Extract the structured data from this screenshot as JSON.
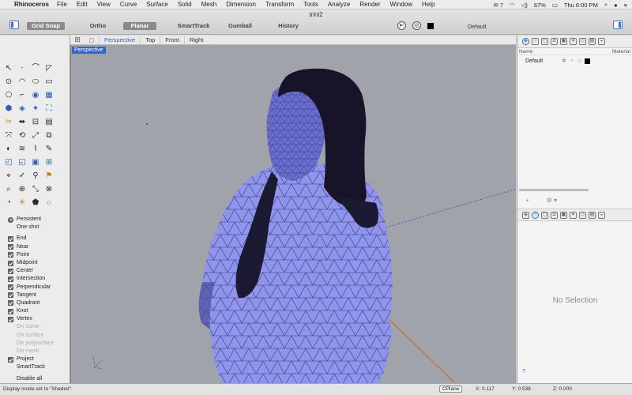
{
  "menubar": {
    "app_name": "Rhinoceros",
    "items": [
      "File",
      "Edit",
      "View",
      "Curve",
      "Surface",
      "Solid",
      "Mesh",
      "Dimension",
      "Transform",
      "Tools",
      "Analyze",
      "Render",
      "Window",
      "Help"
    ],
    "status": {
      "notification_count": "7",
      "battery": "67%",
      "clock": "Thu 6:00 PM"
    }
  },
  "window": {
    "title": "trini2"
  },
  "toolbar": {
    "toggles": [
      {
        "label": "Grid Snap",
        "on": true
      },
      {
        "label": "Ortho",
        "on": false
      },
      {
        "label": "Planar",
        "on": true
      },
      {
        "label": "SmartTrack",
        "on": false
      },
      {
        "label": "Gumball",
        "on": false
      },
      {
        "label": "History",
        "on": false
      }
    ],
    "current_layer": "Default"
  },
  "viewport": {
    "tabs": [
      "Perspective",
      "Top",
      "Front",
      "Right"
    ],
    "active_tab": "Perspective",
    "label": "Perspective",
    "colors": {
      "background": "#a1a3ab",
      "mesh_fill": "#8f95ec",
      "mesh_dark": "#6a6fcf",
      "hair": "#17142a",
      "wire": "#1e1f4a"
    }
  },
  "osnap": {
    "mode_items": [
      {
        "label": "Persistent",
        "checked": true,
        "radio": true
      },
      {
        "label": "One shot",
        "checked": false,
        "radio": true
      }
    ],
    "items": [
      {
        "label": "End",
        "checked": true
      },
      {
        "label": "Near",
        "checked": true
      },
      {
        "label": "Point",
        "checked": true
      },
      {
        "label": "Midpoint",
        "checked": true
      },
      {
        "label": "Center",
        "checked": true
      },
      {
        "label": "Intersection",
        "checked": true
      },
      {
        "label": "Perpendicular",
        "checked": true
      },
      {
        "label": "Tangent",
        "checked": true
      },
      {
        "label": "Quadrant",
        "checked": true
      },
      {
        "label": "Knot",
        "checked": true
      },
      {
        "label": "Vertex",
        "checked": true
      }
    ],
    "sub_items": [
      "On curve",
      "On surface",
      "On polysurface",
      "On mesh"
    ],
    "extra_items": [
      {
        "label": "Project",
        "checked": true
      },
      {
        "label": "SmartTrack",
        "checked": false
      }
    ],
    "disable_all": "Disable all"
  },
  "layers_panel": {
    "col_name": "Name",
    "col_material": "Material",
    "rows": [
      {
        "name": "Default",
        "color": "#000000"
      }
    ]
  },
  "properties_panel": {
    "empty_text": "No Selection",
    "help": "?"
  },
  "statusbar": {
    "message": "Display mode set to \"Shaded\".",
    "cplane": "CPlane",
    "x": "X: 0.117",
    "y": "Y: 0.538",
    "z": "Z: 0.000"
  }
}
